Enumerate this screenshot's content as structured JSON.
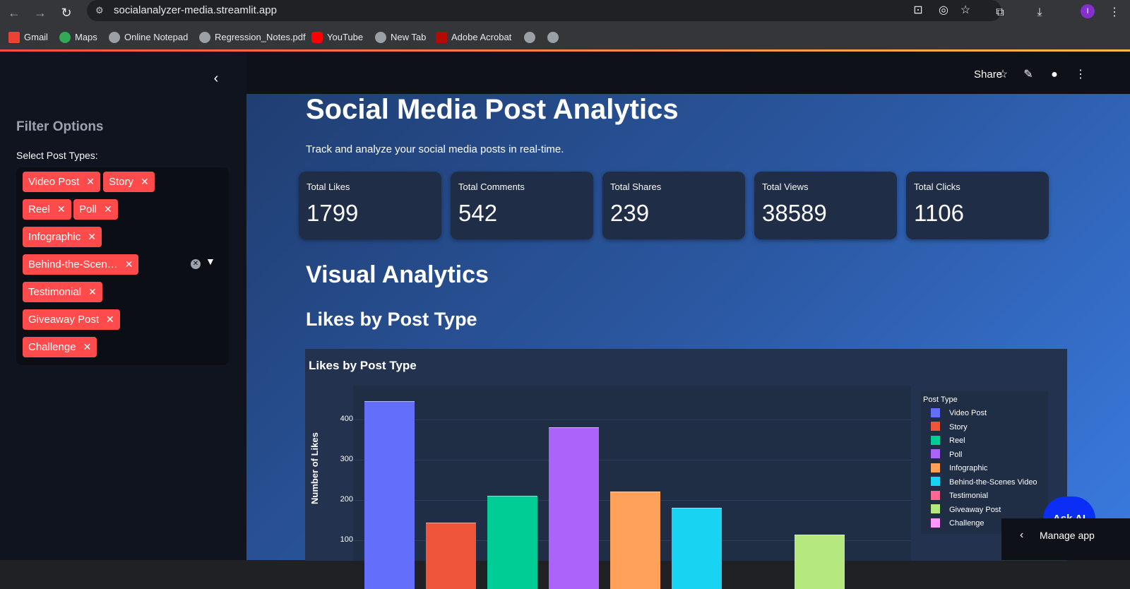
{
  "browser": {
    "url": "socialanalyzer-media.streamlit.app",
    "profile_initial": "I",
    "bookmarks": [
      {
        "label": "Gmail"
      },
      {
        "label": "Maps"
      },
      {
        "label": "Online Notepad"
      },
      {
        "label": "Regression_Notes.pdf"
      },
      {
        "label": "YouTube"
      },
      {
        "label": "New Tab"
      },
      {
        "label": "Adobe Acrobat"
      }
    ]
  },
  "sidebar": {
    "title": "Filter Options",
    "select_label": "Select Post Types:",
    "selected_tags": [
      "Video Post",
      "Story",
      "Reel",
      "Poll",
      "Infographic",
      "Behind-the-Scen…",
      "Testimonial",
      "Giveaway Post",
      "Challenge"
    ]
  },
  "header": {
    "share_label": "Share"
  },
  "main": {
    "title": "Social Media Post Analytics",
    "subtitle": "Track and analyze your social media posts in real-time.",
    "metrics": [
      {
        "label": "Total Likes",
        "value": "1799"
      },
      {
        "label": "Total Comments",
        "value": "542"
      },
      {
        "label": "Total Shares",
        "value": "239"
      },
      {
        "label": "Total Views",
        "value": "38589"
      },
      {
        "label": "Total Clicks",
        "value": "1106"
      }
    ],
    "section_title": "Visual Analytics",
    "chart_heading": "Likes by Post Type"
  },
  "chart_data": {
    "type": "bar",
    "title": "Likes by Post Type",
    "xlabel": "",
    "ylabel": "Number of Likes",
    "y_ticks": [
      100,
      200,
      300,
      400
    ],
    "legend_title": "Post Type",
    "legend_position": "right",
    "categories": [
      "Video Post",
      "Story",
      "Reel",
      "Poll",
      "Infographic",
      "Behind-the-Scenes Video",
      "Testimonial",
      "Giveaway Post",
      "Challenge"
    ],
    "values": [
      446,
      143,
      211,
      380,
      221,
      180,
      0,
      114,
      0
    ],
    "colors": [
      "#636efa",
      "#ef553b",
      "#00cc96",
      "#ab63fa",
      "#ffa15a",
      "#19d3f3",
      "#ff6692",
      "#b6e880",
      "#ff97ff"
    ]
  },
  "buttons": {
    "ask_ai": "Ask AI",
    "manage_app": "Manage app"
  }
}
